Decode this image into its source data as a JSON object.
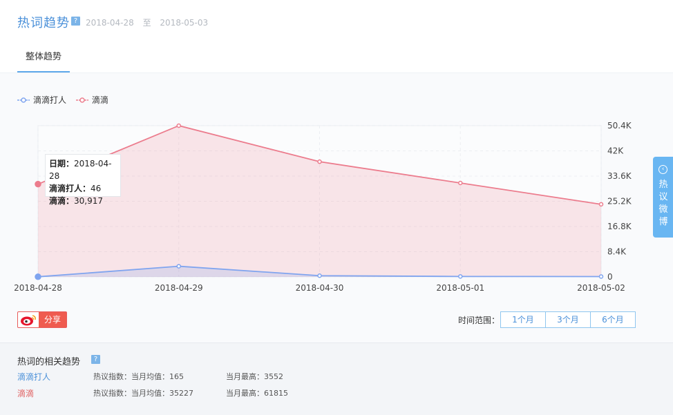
{
  "header": {
    "title": "热词趋势",
    "help_mark": "?",
    "date_from": "2018-04-28",
    "date_sep": "至",
    "date_to": "2018-05-03",
    "tab_label": "整体趋势"
  },
  "tooltip": {
    "date_key": "日期：",
    "date_val": "2018-04-28",
    "s1_key": "滴滴打人：",
    "s1_val": "46",
    "s2_key": "滴滴：",
    "s2_val": "30,917"
  },
  "side_tab": {
    "label_chars": [
      "热",
      "议",
      "微",
      "博"
    ]
  },
  "share": {
    "label": "分享"
  },
  "range": {
    "label": "时间范围：",
    "options": [
      "1个月",
      "3个月",
      "6个月"
    ]
  },
  "related": {
    "title": "热词的相关趋势",
    "help_mark": "?",
    "rows": [
      {
        "name": "滴滴打人",
        "avg": "热议指数：当月均值：165",
        "max": "当月最高：3552"
      },
      {
        "name": "滴滴",
        "avg": "热议指数：当月均值：35227",
        "max": "当月最高：61815"
      }
    ]
  },
  "colors": {
    "series_blue": "#7fa4ef",
    "series_pink": "#ec7c8d",
    "accent": "#4a90d9"
  },
  "chart_data": {
    "type": "area",
    "x": [
      "2018-04-28",
      "2018-04-29",
      "2018-04-30",
      "2018-05-01",
      "2018-05-02"
    ],
    "series": [
      {
        "name": "滴滴打人",
        "values": [
          46,
          3552,
          400,
          150,
          120
        ],
        "color": "#7fa4ef"
      },
      {
        "name": "滴滴",
        "values": [
          30917,
          50400,
          38400,
          31300,
          24200
        ],
        "color": "#ec7c8d"
      }
    ],
    "yaxis_position": "right",
    "ylim": [
      0,
      50400
    ],
    "yticks": [
      0,
      8400,
      16800,
      25200,
      33600,
      42000,
      50400
    ],
    "ytick_labels": [
      "0",
      "8.4K",
      "16.8K",
      "25.2K",
      "33.6K",
      "42K",
      "50.4K"
    ],
    "grid": true,
    "legend_position": "top-left"
  }
}
